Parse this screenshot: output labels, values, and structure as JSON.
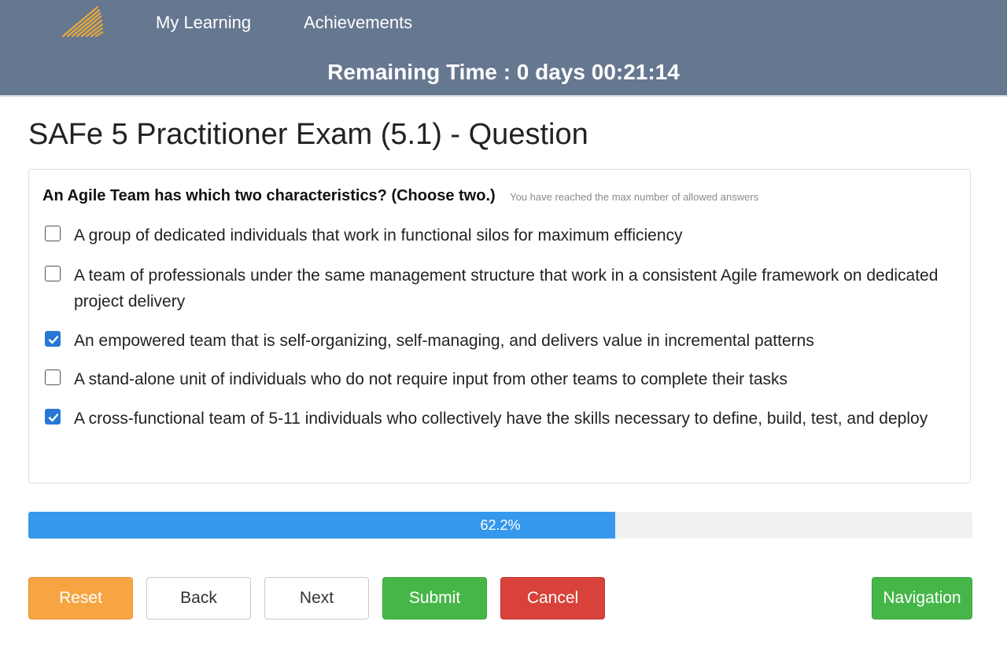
{
  "header": {
    "logo": "striped-triangle-logo",
    "nav": [
      {
        "label": "My Learning"
      },
      {
        "label": "Achievements"
      }
    ],
    "timer": "Remaining Time : 0 days 00:21:14"
  },
  "page": {
    "title": "SAFe 5 Practitioner Exam (5.1) - Question"
  },
  "question": {
    "text": "An Agile Team has which two characteristics? (Choose two.)",
    "note": "You have reached the max number of allowed answers",
    "options": [
      {
        "label": "A group of dedicated individuals that work in functional silos for maximum efficiency",
        "checked": false
      },
      {
        "label": "A team of professionals under the same management structure that work in a consistent Agile framework on dedicated project delivery",
        "checked": false
      },
      {
        "label": "An empowered team that is self-organizing, self-managing, and delivers value in incremental patterns",
        "checked": true
      },
      {
        "label": "A stand-alone unit of individuals who do not require input from other teams to complete their tasks",
        "checked": false
      },
      {
        "label": "A cross-functional team of 5-11 individuals who collectively have the skills necessary to define, build, test, and deploy",
        "checked": true
      }
    ]
  },
  "progress": {
    "percent": 62.2,
    "label": "62.2%"
  },
  "buttons": {
    "reset": "Reset",
    "back": "Back",
    "next": "Next",
    "submit": "Submit",
    "cancel": "Cancel",
    "navigation": "Navigation"
  },
  "colors": {
    "header_bg": "#667790",
    "checkbox_checked": "#2778d6",
    "progress_fill": "#3598ec",
    "reset": "#f7a543",
    "submit": "#47b649",
    "cancel": "#d9413b",
    "navigation": "#47b649",
    "logo": "#e8a93a"
  }
}
